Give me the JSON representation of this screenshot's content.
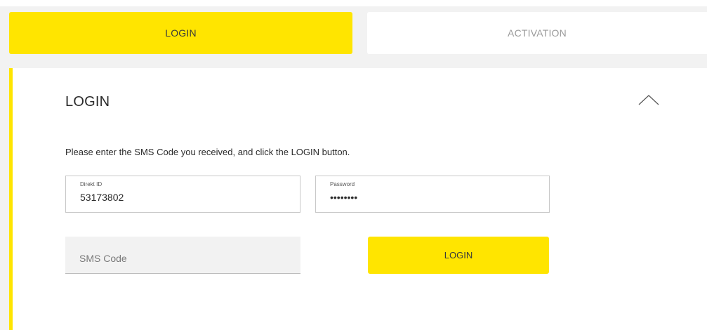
{
  "tabs": {
    "login_label": "LOGIN",
    "activation_label": "ACTIVATION"
  },
  "panel": {
    "title": "LOGIN",
    "collapse_icon": "chevron-up-icon",
    "instruction": "Please enter the SMS Code you received, and click the LOGIN button."
  },
  "form": {
    "direkt_id": {
      "label": "Direkt ID",
      "value": "53173802"
    },
    "password": {
      "label": "Password",
      "value": "••••••••"
    },
    "sms_code": {
      "placeholder": "SMS Code",
      "value": ""
    },
    "login_button_label": "LOGIN"
  },
  "colors": {
    "accent": "#ffe500",
    "background": "#f2f2f2",
    "muted_text": "#9a9a9a"
  }
}
